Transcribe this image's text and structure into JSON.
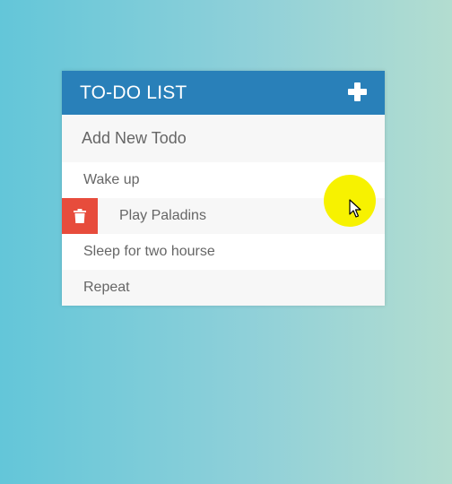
{
  "app": {
    "title": "TO-DO LIST"
  },
  "colors": {
    "header": "#2980b9",
    "delete": "#e74c3c",
    "cursor_highlight": "#f7f200"
  },
  "new_todo": {
    "placeholder": "Add New Todo",
    "value": ""
  },
  "todos": [
    {
      "text": "Wake up"
    },
    {
      "text": "Play Paladins"
    },
    {
      "text": "Sleep for two hourse"
    },
    {
      "text": "Repeat"
    }
  ],
  "icons": {
    "add": "plus-icon",
    "delete": "trash-icon",
    "cursor": "mouse-pointer-icon"
  }
}
